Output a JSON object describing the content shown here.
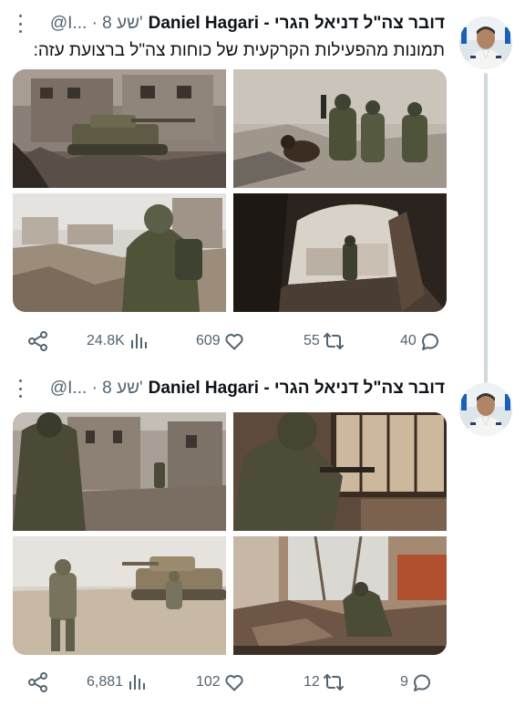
{
  "colors": {
    "text": "#0f1419",
    "muted": "#536471",
    "thread_line": "#cfd9de",
    "background": "#ffffff"
  },
  "tweets": [
    {
      "author_name": "דובר צה\"ל דניאל הגרי - Daniel Hagari",
      "meta": "@I... · 8 שע'",
      "text": "תמונות מהפעילות הקרקעית של כוחות צה\"ל ברצועת עזה:",
      "media_count": 4,
      "stats": {
        "views": "24.8K",
        "likes": "609",
        "retweets": "55",
        "replies": "40"
      }
    },
    {
      "author_name": "דובר צה\"ל דניאל הגרי - Daniel Hagari",
      "meta": "@I... · 8 שע'",
      "text": "",
      "media_count": 4,
      "stats": {
        "views": "6,881",
        "likes": "102",
        "retweets": "12",
        "replies": "9"
      }
    }
  ],
  "icons": {
    "share": "share-icon",
    "views": "views-icon",
    "like": "heart-icon",
    "retweet": "retweet-icon",
    "reply": "reply-icon",
    "more": "more-icon"
  }
}
